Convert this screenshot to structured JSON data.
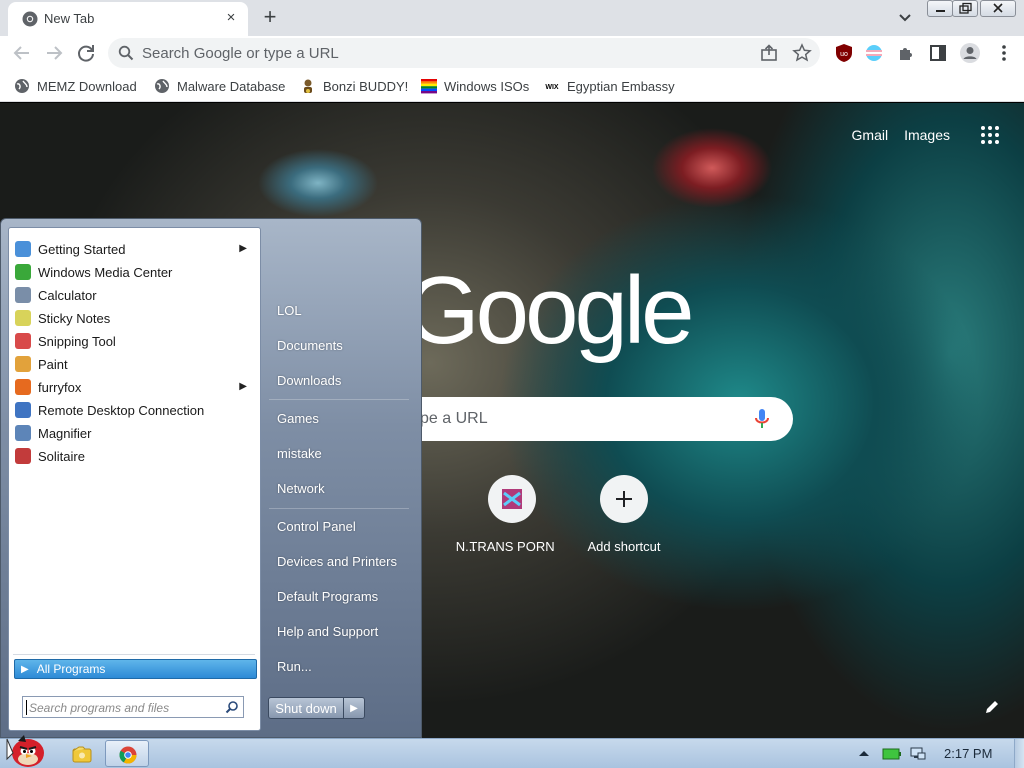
{
  "browser": {
    "tab": {
      "title": "New Tab",
      "close_glyph": "×"
    },
    "new_tab_glyph": "+",
    "omnibox": {
      "placeholder": "Search Google or type a URL"
    },
    "bookmarks": [
      {
        "label": "MEMZ Download",
        "icon": "globe-icon"
      },
      {
        "label": "Malware Database",
        "icon": "globe-icon"
      },
      {
        "label": "Bonzi BUDDY!",
        "icon": "bonzi-icon"
      },
      {
        "label": "Windows ISOs",
        "icon": "rainbow-flag-icon"
      },
      {
        "label": "Egyptian Embassy",
        "icon": "wix-icon"
      }
    ]
  },
  "newtab": {
    "nav": {
      "gmail": "Gmail",
      "images": "Images"
    },
    "logo_text": "Google",
    "search_placeholder_visible": "pe a URL",
    "shortcuts": [
      {
        "label": "N...",
        "icon": "partial-icon"
      },
      {
        "label": "TRANS PORN",
        "icon": "site-icon"
      },
      {
        "label": "Add shortcut",
        "icon": "plus-icon"
      }
    ]
  },
  "start_menu": {
    "programs": [
      {
        "label": "Getting Started",
        "has_submenu": true,
        "color": "#4a90d9"
      },
      {
        "label": "Windows Media Center",
        "has_submenu": false,
        "color": "#3aa83a"
      },
      {
        "label": "Calculator",
        "has_submenu": false,
        "color": "#7a8ea8"
      },
      {
        "label": "Sticky Notes",
        "has_submenu": false,
        "color": "#d8d35a"
      },
      {
        "label": "Snipping Tool",
        "has_submenu": false,
        "color": "#d84a4a"
      },
      {
        "label": "Paint",
        "has_submenu": false,
        "color": "#e2a23b"
      },
      {
        "label": "furryfox",
        "has_submenu": true,
        "color": "#e66a1f"
      },
      {
        "label": "Remote Desktop Connection",
        "has_submenu": false,
        "color": "#3f74c2"
      },
      {
        "label": "Magnifier",
        "has_submenu": false,
        "color": "#5d85b8"
      },
      {
        "label": "Solitaire",
        "has_submenu": false,
        "color": "#c23b3b"
      }
    ],
    "all_programs": "All Programs",
    "search_placeholder": "Search programs and files",
    "places": [
      "LOL",
      "Documents",
      "Downloads",
      "Games",
      "mistake",
      "Network",
      "Control Panel",
      "Devices and Printers",
      "Default Programs",
      "Help and Support",
      "Run..."
    ],
    "shutdown": "Shut down"
  },
  "taskbar": {
    "clock": "2:17 PM"
  }
}
